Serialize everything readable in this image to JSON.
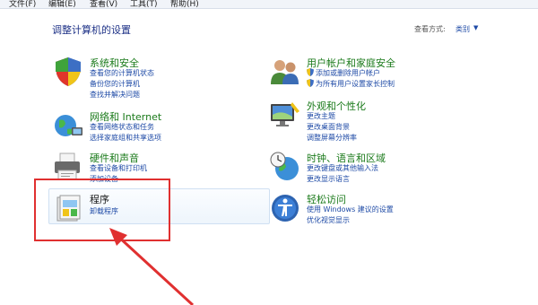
{
  "menu": [
    "文件(F)",
    "编辑(E)",
    "查看(V)",
    "工具(T)",
    "帮助(H)"
  ],
  "page_title": "调整计算机的设置",
  "view_by": {
    "label": "查看方式:",
    "value": "类别"
  },
  "categories": {
    "system": {
      "title": "系统和安全",
      "links": [
        "查看您的计算机状态",
        "备份您的计算机",
        "查找并解决问题"
      ]
    },
    "network": {
      "title": "网络和 Internet",
      "links": [
        "查看网络状态和任务",
        "选择家庭组和共享选项"
      ]
    },
    "hardware": {
      "title": "硬件和声音",
      "links": [
        "查看设备和打印机",
        "添加设备"
      ]
    },
    "programs": {
      "title": "程序",
      "links": [
        "卸载程序"
      ]
    },
    "users": {
      "title": "用户帐户和家庭安全",
      "links": [
        "添加或删除用户帐户",
        "为所有用户设置家长控制"
      ]
    },
    "appearance": {
      "title": "外观和个性化",
      "links": [
        "更改主题",
        "更改桌面背景",
        "调整屏幕分辨率"
      ]
    },
    "clock": {
      "title": "时钟、语言和区域",
      "links": [
        "更改键盘或其他输入法",
        "更改显示语言"
      ]
    },
    "access": {
      "title": "轻松访问",
      "links": [
        "使用 Windows 建议的设置",
        "优化视觉显示"
      ]
    }
  },
  "colors": {
    "title_green": "#1a7a1a",
    "link_blue": "#1e4aa6",
    "heading_blue": "#1e3287",
    "annotation_red": "#e03030"
  }
}
